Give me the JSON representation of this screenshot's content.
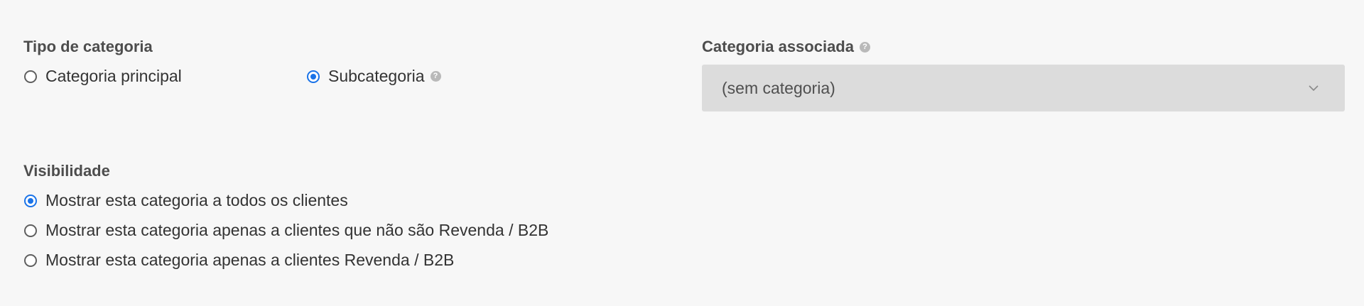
{
  "category_type": {
    "label": "Tipo de categoria",
    "options": [
      {
        "label": "Categoria principal",
        "checked": false
      },
      {
        "label": "Subcategoria",
        "checked": true
      }
    ],
    "help_icon": "question-circle-icon"
  },
  "associated_category": {
    "label": "Categoria associada",
    "help_icon": "question-circle-icon",
    "selected_value": "(sem categoria)",
    "dropdown_icon": "chevron-down-icon"
  },
  "visibility": {
    "label": "Visibilidade",
    "options": [
      {
        "label": "Mostrar esta categoria a todos os clientes",
        "checked": true
      },
      {
        "label": "Mostrar esta categoria apenas a clientes que não são Revenda / B2B",
        "checked": false
      },
      {
        "label": "Mostrar esta categoria apenas a clientes Revenda / B2B",
        "checked": false
      }
    ]
  },
  "colors": {
    "accent": "#1a73e8",
    "background": "#f7f7f7",
    "select_background": "#dcdcdc"
  }
}
